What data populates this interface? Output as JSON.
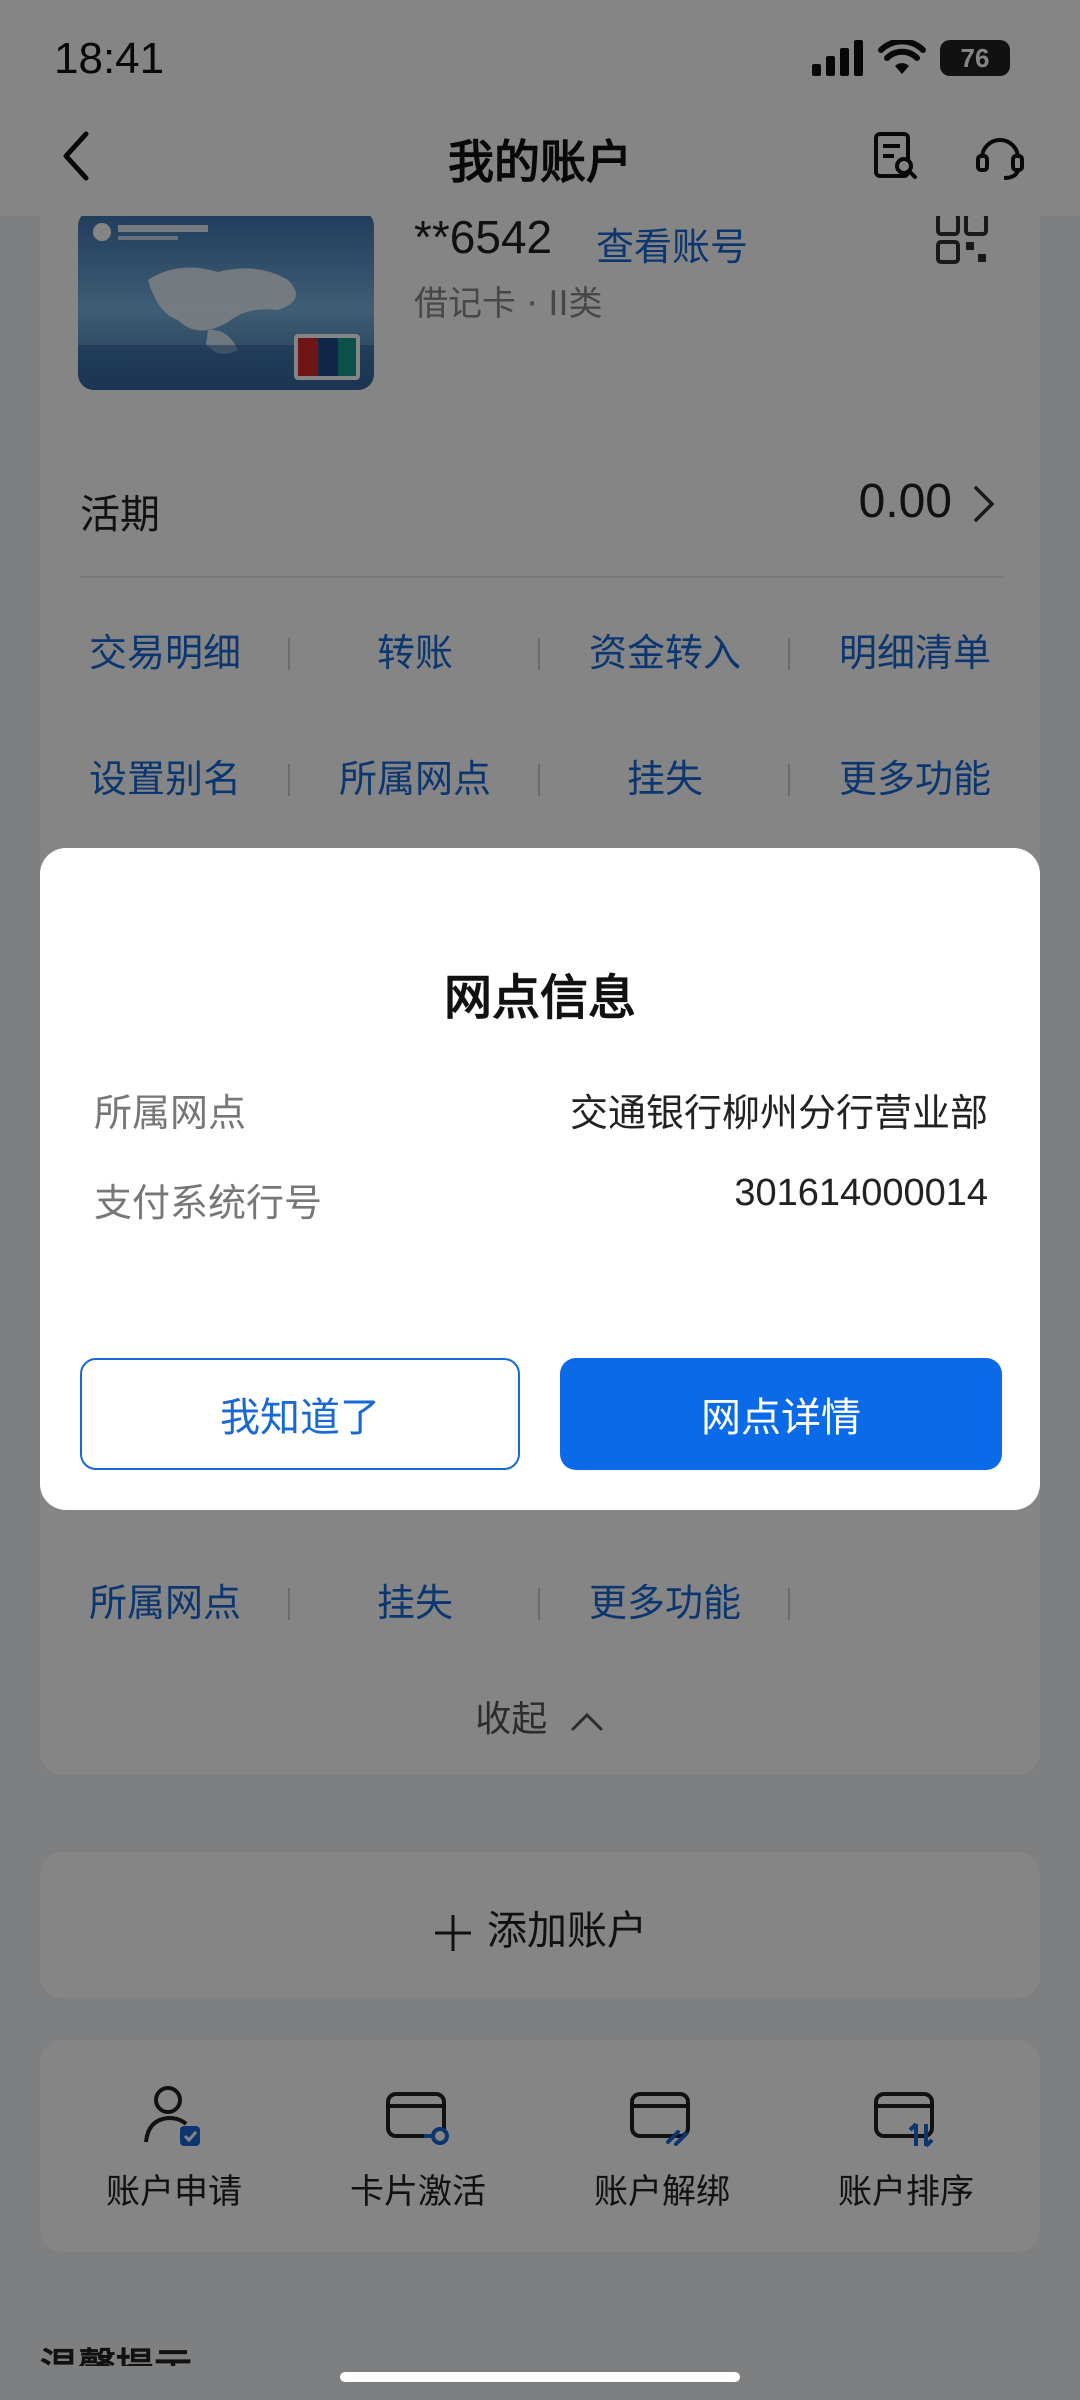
{
  "status_bar": {
    "time": "18:41",
    "battery": "76"
  },
  "nav": {
    "title": "我的账户"
  },
  "account": {
    "card_number": "**6542",
    "view_account_link": "查看账号",
    "card_type": "借记卡 · II类",
    "demand_label": "活期",
    "demand_balance": "0.00"
  },
  "actions_row1": [
    "交易明细",
    "转账",
    "资金转入",
    "明细清单"
  ],
  "actions_row2": [
    "设置别名",
    "所属网点",
    "挂失",
    "更多功能"
  ],
  "actions_row3": [
    "所属网点",
    "挂失",
    "更多功能"
  ],
  "collapse_label": "收起",
  "add_account_label": "添加账户",
  "tools": [
    {
      "label": "账户申请",
      "icon": "account-apply-icon"
    },
    {
      "label": "卡片激活",
      "icon": "card-activate-icon"
    },
    {
      "label": "账户解绑",
      "icon": "account-unbind-icon"
    },
    {
      "label": "账户排序",
      "icon": "account-sort-icon"
    }
  ],
  "footer_fragment": "温馨提示",
  "dialog": {
    "title": "网点信息",
    "rows": [
      {
        "label": "所属网点",
        "value": "交通银行柳州分行营业部"
      },
      {
        "label": "支付系统行号",
        "value": "301614000014"
      }
    ],
    "dismiss_button": "我知道了",
    "detail_button": "网点详情"
  },
  "colors": {
    "accent": "#1868d6",
    "primary_button": "#0a6ae8",
    "overlay": "rgba(0,0,0,0.48)"
  }
}
